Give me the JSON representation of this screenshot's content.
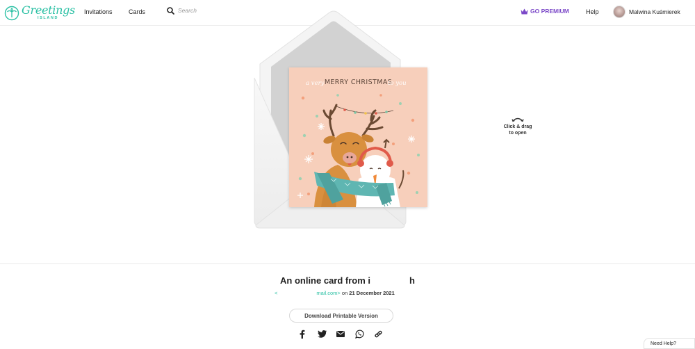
{
  "header": {
    "logo_text": "Greetings",
    "logo_subtext": "ISLAND",
    "nav_invitations": "Invitations",
    "nav_cards": "Cards",
    "search_placeholder": "Search",
    "premium_label": "GO PREMIUM",
    "help_label": "Help",
    "user_name": "Malwina Kuśmierek"
  },
  "card": {
    "title": "MERRY CHRISTMAS",
    "script_left": "a very",
    "script_right": "to you",
    "drag_hint_line1": "Click & drag",
    "drag_hint_line2": "to open"
  },
  "info": {
    "title_prefix": "An online card from i",
    "title_suffix": "h",
    "sender_prefix": "<",
    "sender_domain": "mail.com>",
    "sent_on": " on ",
    "date": "21 December 2021",
    "download_label": "Download Printable Version"
  },
  "share_icons": [
    "facebook-icon",
    "twitter-icon",
    "email-icon",
    "whatsapp-icon",
    "link-icon"
  ],
  "need_help_label": "Need Help?",
  "colors": {
    "brand": "#2bc0a4",
    "premium": "#7b48c8",
    "card_background": "#f7cfbb"
  }
}
